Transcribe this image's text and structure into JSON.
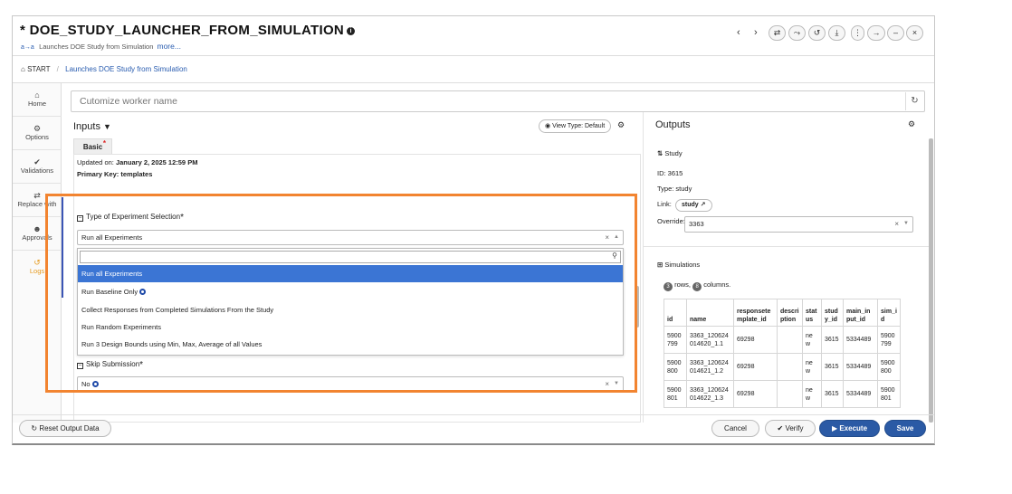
{
  "header": {
    "title": "* DOE_STUDY_LAUNCHER_FROM_SIMULATION",
    "subtitle_icon": "a→a",
    "subtitle": "Launches DOE Study from Simulation",
    "more_label": "more...",
    "buttons": [
      "⇄",
      "⤳",
      "↺",
      "⤓",
      "⋮",
      "→",
      "–",
      "×"
    ]
  },
  "breadcrumb": {
    "root": "START",
    "separator": "/",
    "current": "Launches DOE Study from Simulation"
  },
  "leftnav": {
    "items": [
      {
        "label": "Home",
        "icon": "⌂"
      },
      {
        "label": "Options",
        "icon": "⚙"
      },
      {
        "label": "Validations",
        "icon": "✔"
      },
      {
        "label": "Replace with",
        "icon": "⇄"
      },
      {
        "label": "Approvals",
        "icon": "☻"
      },
      {
        "label": "Logs",
        "icon": "↺"
      }
    ]
  },
  "worker": {
    "placeholder": "Cutomize worker name"
  },
  "inputs": {
    "title": "Inputs",
    "view_type": "View Type: Default",
    "tab": "Basic",
    "updated_prefix": "Updated on:",
    "updated_value": "January 2, 2025 12:59 PM",
    "primary_key": "Primary Key: templates",
    "type_label": "Type of Experiment Selection",
    "type_value": "Run all Experiments",
    "options": [
      "Run all Experiments",
      "Run Baseline Only",
      "Collect Responses from Completed Simulations From the Study",
      "Run Random Experiments",
      "Run 3 Design Bounds using Min, Max, Average of all Values"
    ],
    "skip_label": "Skip Submission",
    "skip_value": "No"
  },
  "outputs": {
    "title": "Outputs",
    "study_heading": "Study",
    "id_line": "ID:  3615",
    "type_line": "Type:  study",
    "link_label": "Link:",
    "link_value": "study",
    "override_label": "Override:",
    "override_value": "3363",
    "sim_heading": "Simulations",
    "rows_count": "3",
    "rows_label": "rows,",
    "cols_count": "8",
    "cols_label": "columns.",
    "table": {
      "headers": [
        "id",
        "name",
        "responsete mplate_id",
        "descri ption",
        "stat us",
        "stud y_id",
        "main_in put_id",
        "sim_i d"
      ],
      "rows": [
        [
          "5900 799",
          "3363_120624 014620_1.1",
          "69298",
          "",
          "ne w",
          "3615",
          "5334489",
          "5900 799"
        ],
        [
          "5900 800",
          "3363_120624 014621_1.2",
          "69298",
          "",
          "ne w",
          "3615",
          "5334489",
          "5900 800"
        ],
        [
          "5900 801",
          "3363_120624 014622_1.3",
          "69298",
          "",
          "ne w",
          "3615",
          "5334489",
          "5900 801"
        ]
      ]
    }
  },
  "footer": {
    "reset_label": "Reset Output Data",
    "cancel_label": "Cancel",
    "verify_label": "Verify",
    "execute_label": "Execute",
    "save_label": "Save"
  },
  "colors": {
    "accent": "#2b5aa5",
    "highlight": "#f28430",
    "selected": "#3b75d4",
    "logs": "#e69a1e"
  }
}
